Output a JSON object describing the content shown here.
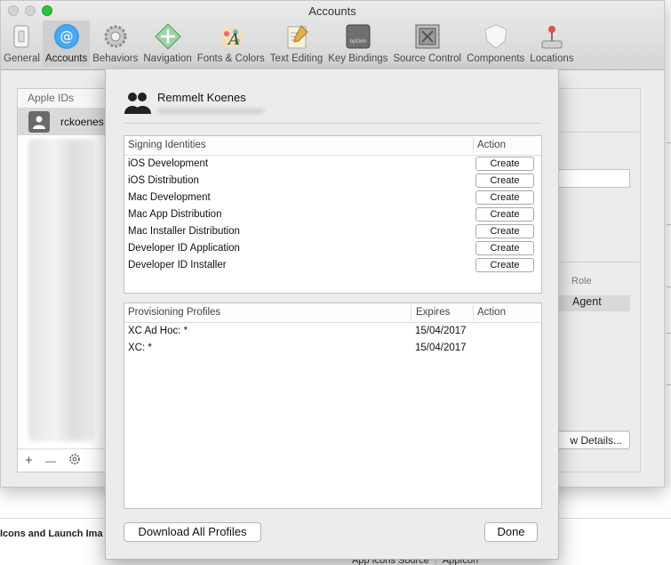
{
  "window": {
    "title": "Accounts"
  },
  "toolbar": {
    "items": [
      {
        "label": "General",
        "icon": "general-switch-icon"
      },
      {
        "label": "Accounts",
        "icon": "at-sign-icon"
      },
      {
        "label": "Behaviors",
        "icon": "gear-icon"
      },
      {
        "label": "Navigation",
        "icon": "arrows-diamond-icon"
      },
      {
        "label": "Fonts & Colors",
        "icon": "font-palette-icon"
      },
      {
        "label": "Text Editing",
        "icon": "notepad-pencil-icon"
      },
      {
        "label": "Key Bindings",
        "icon": "option-key-icon"
      },
      {
        "label": "Source Control",
        "icon": "vault-icon"
      },
      {
        "label": "Components",
        "icon": "shield-icon"
      },
      {
        "label": "Locations",
        "icon": "joystick-icon"
      }
    ],
    "active": "Accounts"
  },
  "apple_ids": {
    "header": "Apple IDs",
    "account_name": "rckoenes",
    "footer": {
      "add": "+",
      "remove": "—"
    }
  },
  "right_panel": {
    "role_header": "Role",
    "role_value": "Agent",
    "details_button": "w Details..."
  },
  "sheet": {
    "user_name": "Remmelt Koenes",
    "signing": {
      "headers": {
        "identity": "Signing Identities",
        "action": "Action"
      },
      "rows": [
        {
          "name": "iOS Development",
          "action": "Create"
        },
        {
          "name": "iOS Distribution",
          "action": "Create"
        },
        {
          "name": "Mac Development",
          "action": "Create"
        },
        {
          "name": "Mac App Distribution",
          "action": "Create"
        },
        {
          "name": "Mac Installer Distribution",
          "action": "Create"
        },
        {
          "name": "Developer ID Application",
          "action": "Create"
        },
        {
          "name": "Developer ID Installer",
          "action": "Create"
        }
      ]
    },
    "provisioning": {
      "headers": {
        "profile": "Provisioning Profiles",
        "expires": "Expires",
        "action": "Action"
      },
      "rows": [
        {
          "name": "XC Ad Hoc: *",
          "expires": "15/04/2017"
        },
        {
          "name": "XC: *",
          "expires": "15/04/2017"
        }
      ]
    },
    "download_button": "Download All Profiles",
    "done_button": "Done"
  },
  "background": {
    "heading": "Icons and Launch Ima",
    "row_label": "App Icons Source",
    "row_value": "AppIcon"
  }
}
